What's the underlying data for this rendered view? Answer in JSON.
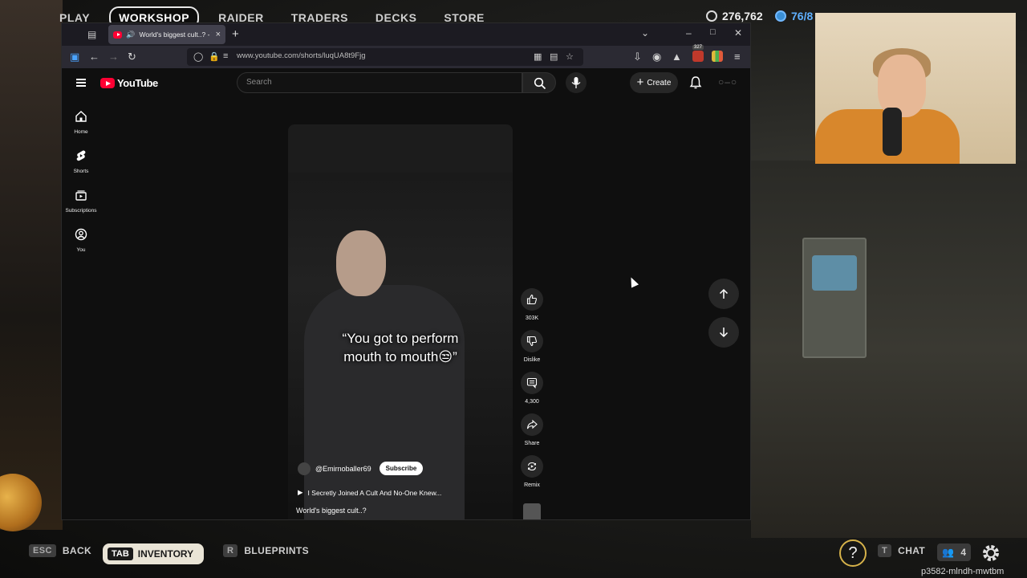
{
  "game": {
    "nav": [
      "PLAY",
      "WORKSHOP",
      "RAIDER",
      "TRADERS",
      "DECKS",
      "STORE"
    ],
    "active_nav": "WORKSHOP",
    "currency_coins": "276,762",
    "currency_tokens": "76/8",
    "bottom_hud": {
      "esc_key": "ESC",
      "back_label": "BACK",
      "tab_key": "TAB",
      "inventory_label": "INVENTORY",
      "r_key": "R",
      "blueprints_label": "BLUEPRINTS",
      "help_label": "?",
      "t_key": "T",
      "chat_label": "CHAT",
      "party_count": "4"
    },
    "session_code": "p3582-mlndh-mwtbm"
  },
  "browser": {
    "tab_title": "World's biggest cult..? - You",
    "url": "www.youtube.com/shorts/luqUA8t9Fjg",
    "extension_badge": "327"
  },
  "youtube": {
    "logo_text": "YouTube",
    "search_placeholder": "Search",
    "create_label": "Create",
    "sidebar": [
      {
        "label": "Home",
        "icon": "home-icon"
      },
      {
        "label": "Shorts",
        "icon": "shorts-icon"
      },
      {
        "label": "Subscriptions",
        "icon": "subscriptions-icon"
      },
      {
        "label": "You",
        "icon": "you-icon"
      }
    ],
    "short": {
      "caption_line1": "“You got to perform",
      "caption_line2": "mouth to mouth😒”",
      "channel": "@Emirnoballer69",
      "subscribe_label": "Subscribe",
      "related_video": "I Secretly Joined A Cult And No-One Knew...",
      "title": "World's biggest cult..?",
      "progress_fraction": 0.86
    },
    "actions": {
      "likes": "303K",
      "dislike_label": "Dislike",
      "comments": "4,300",
      "share_label": "Share",
      "remix_label": "Remix"
    }
  }
}
